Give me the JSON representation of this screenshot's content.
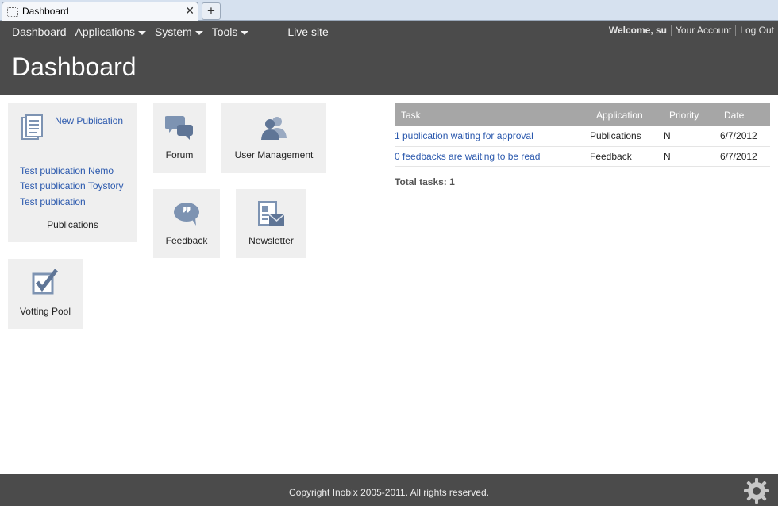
{
  "browser": {
    "tab_title": "Dashboard",
    "close_glyph": "✕",
    "newtab_glyph": "+"
  },
  "nav": {
    "dashboard": "Dashboard",
    "applications": "Applications",
    "system": "System",
    "tools": "Tools",
    "live_site": "Live site"
  },
  "user": {
    "welcome": "Welcome, su",
    "account": "Your Account",
    "logout": "Log Out"
  },
  "page": {
    "title": "Dashboard"
  },
  "tiles": {
    "publications": {
      "new_link": "New Publication",
      "items": [
        "Test publication Nemo",
        "Test publication Toystory",
        "Test publication"
      ],
      "label": "Publications",
      "icon": "document-icon"
    },
    "forum": {
      "label": "Forum",
      "icon": "chat-bubbles-icon"
    },
    "user_management": {
      "label": "User Management",
      "icon": "users-icon"
    },
    "feedback": {
      "label": "Feedback",
      "icon": "quote-bubble-icon"
    },
    "newsletter": {
      "label": "Newsletter",
      "icon": "newsletter-icon"
    },
    "votting_pool": {
      "label": "Votting Pool",
      "icon": "checkbox-icon"
    }
  },
  "tasks": {
    "headers": [
      "Task",
      "Application",
      "Priority",
      "Date"
    ],
    "rows": [
      {
        "task": "1 publication  waiting for approval",
        "application": "Publications",
        "priority": "N",
        "date": "6/7/2012"
      },
      {
        "task": "0 feedbacks are waiting to be read",
        "application": "Feedback",
        "priority": "N",
        "date": "6/7/2012"
      }
    ],
    "total_label": "Total tasks:",
    "total_value": "1"
  },
  "footer": {
    "copyright": "Copyright Inobix 2005-2011. All rights reserved."
  },
  "colors": {
    "header_bg": "#4b4b4b",
    "tile_bg": "#efefef",
    "link": "#2a58ad",
    "icon": "#7d93b2",
    "table_header": "#a6a6a6"
  }
}
